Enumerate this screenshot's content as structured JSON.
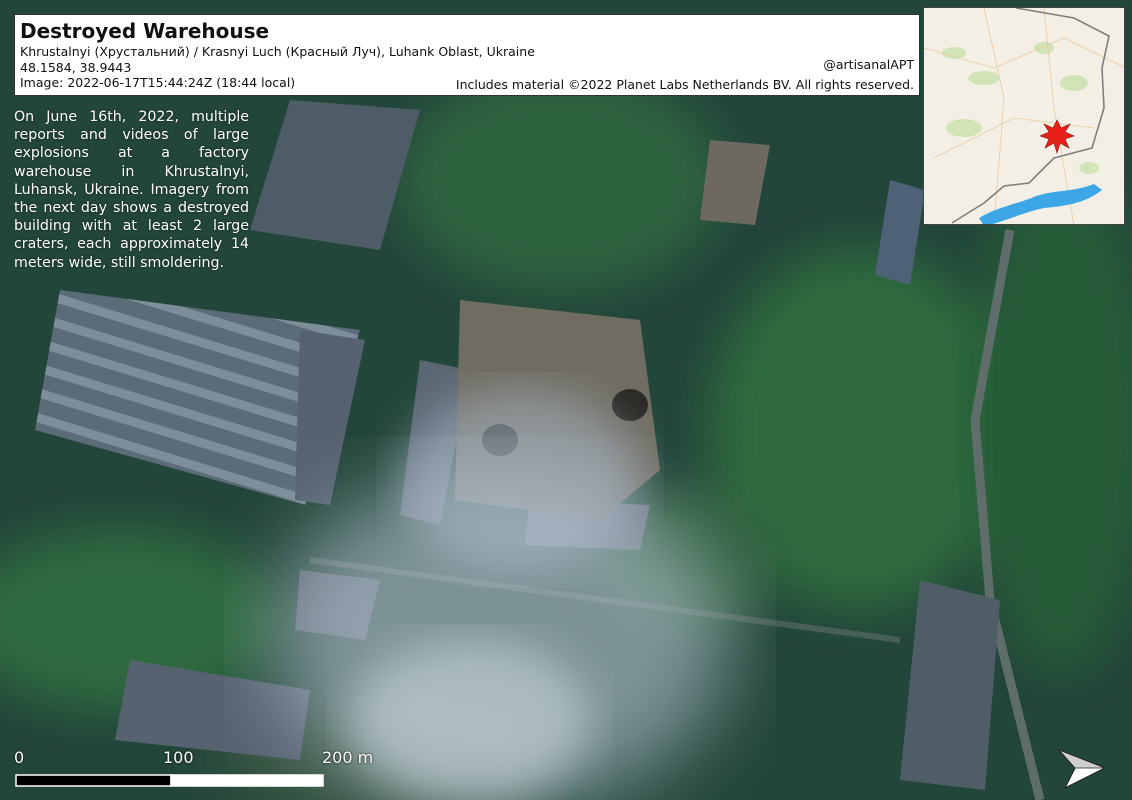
{
  "title": "Destroyed Warehouse",
  "location": "Khrustalnyi (Хрустальний) / Krasnyi Luch (Красный Луч), Luhank Oblast, Ukraine",
  "coordinates": "48.1584, 38.9443",
  "image_time": "Image: 2022-06-17T15:44:24Z (18:44 local)",
  "handle": "@artisanalAPT",
  "credit": "Includes material ©2022 Planet Labs Netherlands BV. All rights reserved.",
  "description": "On June 16th, 2022, multiple reports and videos of large explosions at a factory warehouse in Khrustalnyi, Luhansk, Ukraine. Imagery from the next day shows a destroyed building with at least 2 large craters, each approximately 14 meters wide, still smoldering.",
  "scale_bar": {
    "labels": [
      "0",
      "100",
      "200 m"
    ]
  },
  "colors": {
    "vegetation": "#2e5a3c",
    "smoke": "#b8c6d4",
    "marker": "#e8201a",
    "water": "#3da6e6"
  },
  "icons": {
    "north_arrow": "north-arrow-icon",
    "location_marker": "explosion-marker-icon"
  }
}
